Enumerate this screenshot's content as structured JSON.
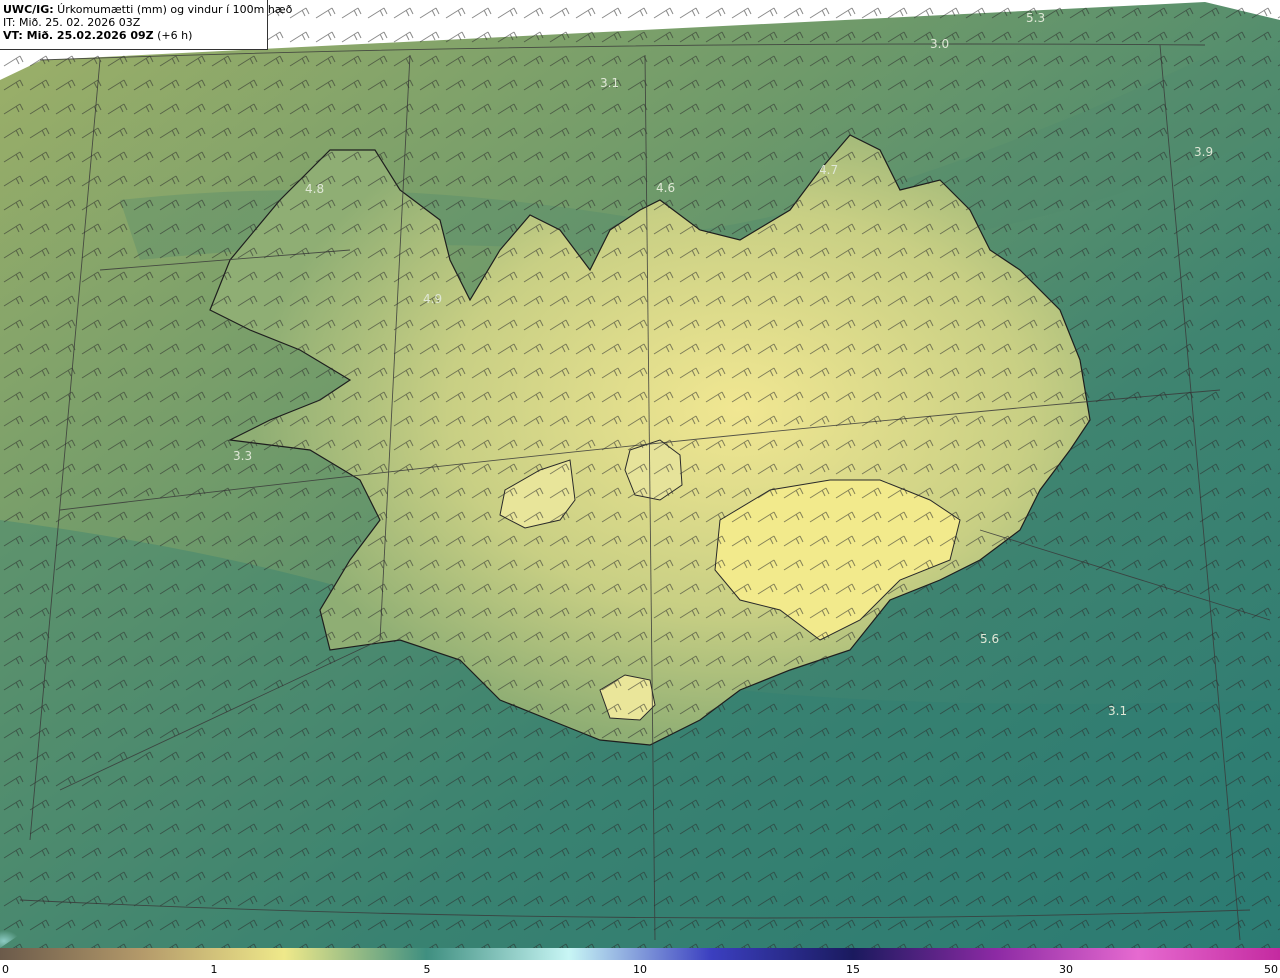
{
  "header": {
    "title_prefix": "UWC/IG:",
    "title_rest": " Úrkomumætti (mm) og vindur í 100m hæð",
    "issue_time": "IT: Mið. 25. 02. 2026 03Z",
    "valid_prefix": "VT: Mið. 25.02.2026 09Z",
    "valid_suffix": " (+6 h)"
  },
  "map_labels": [
    {
      "id": "l1",
      "text": "5.3"
    },
    {
      "id": "l2",
      "text": "3.0"
    },
    {
      "id": "l3",
      "text": "3.1"
    },
    {
      "id": "l4",
      "text": "3.9"
    },
    {
      "id": "l5",
      "text": "4.8"
    },
    {
      "id": "l6",
      "text": "4.6"
    },
    {
      "id": "l7",
      "text": "4.7"
    },
    {
      "id": "l8",
      "text": "4.9"
    },
    {
      "id": "l9",
      "text": "3.3"
    },
    {
      "id": "l10",
      "text": "5.6"
    },
    {
      "id": "l11",
      "text": "3.1"
    }
  ],
  "legend": {
    "ticks": [
      "0",
      "1",
      "5",
      "10",
      "15",
      "30",
      "50"
    ],
    "colors": [
      "#6b5a4a",
      "#b49a6a",
      "#efe98a",
      "#3f8f80",
      "#c8f6f5",
      "#3b3fc0",
      "#1a1a5e",
      "#8c2aa4",
      "#e66ad0",
      "#c42aa0"
    ]
  }
}
